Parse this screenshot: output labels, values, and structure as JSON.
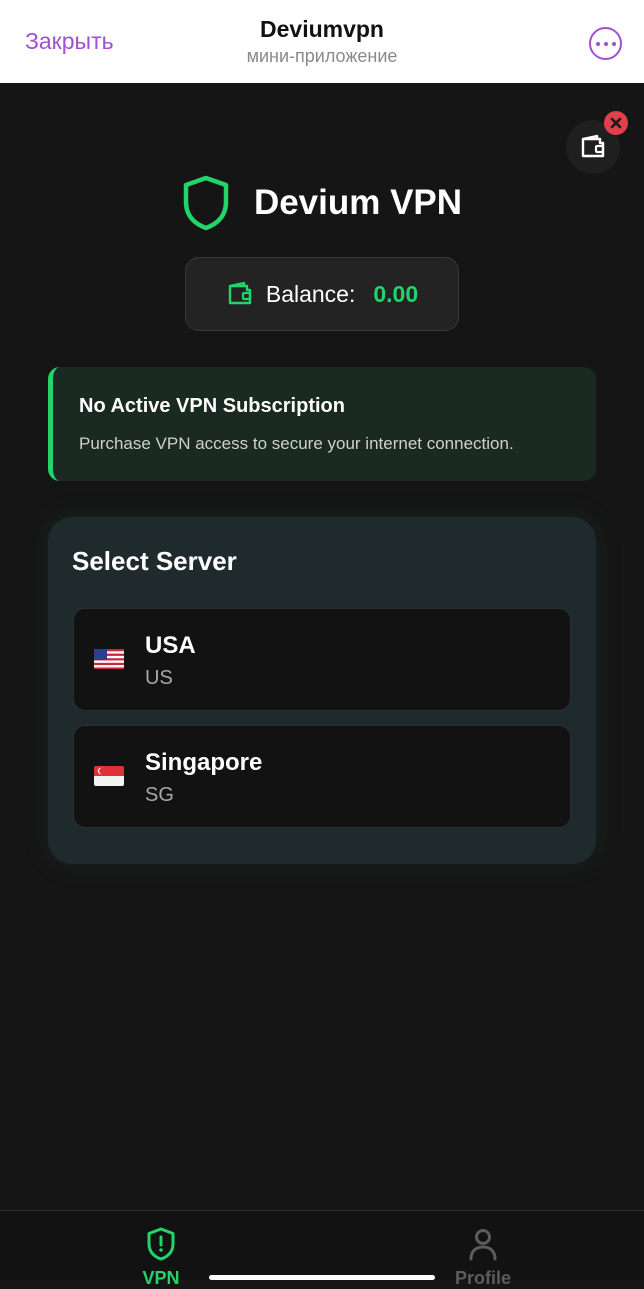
{
  "topbar": {
    "close_label": "Закрыть",
    "title": "Deviumvpn",
    "subtitle": "мини-приложение",
    "more_icon": "more-horizontal-icon"
  },
  "brand": {
    "name": "Devium VPN",
    "icon": "shield-icon",
    "accent_color": "#22d46a"
  },
  "balance": {
    "label": "Balance:",
    "value": "0.00",
    "icon": "wallet-icon"
  },
  "notice": {
    "title": "No Active VPN Subscription",
    "text": "Purchase VPN access to secure your internet connection."
  },
  "servers": {
    "title": "Select Server",
    "items": [
      {
        "name": "USA",
        "code": "US",
        "flag": "us-flag-icon"
      },
      {
        "name": "Singapore",
        "code": "SG",
        "flag": "sg-flag-icon"
      }
    ]
  },
  "nav": {
    "items": [
      {
        "label": "VPN",
        "icon": "shield-alert-icon",
        "active": true,
        "color": "#22d46a"
      },
      {
        "label": "Profile",
        "icon": "user-icon",
        "active": false,
        "color": "#5c5c5c"
      }
    ]
  }
}
